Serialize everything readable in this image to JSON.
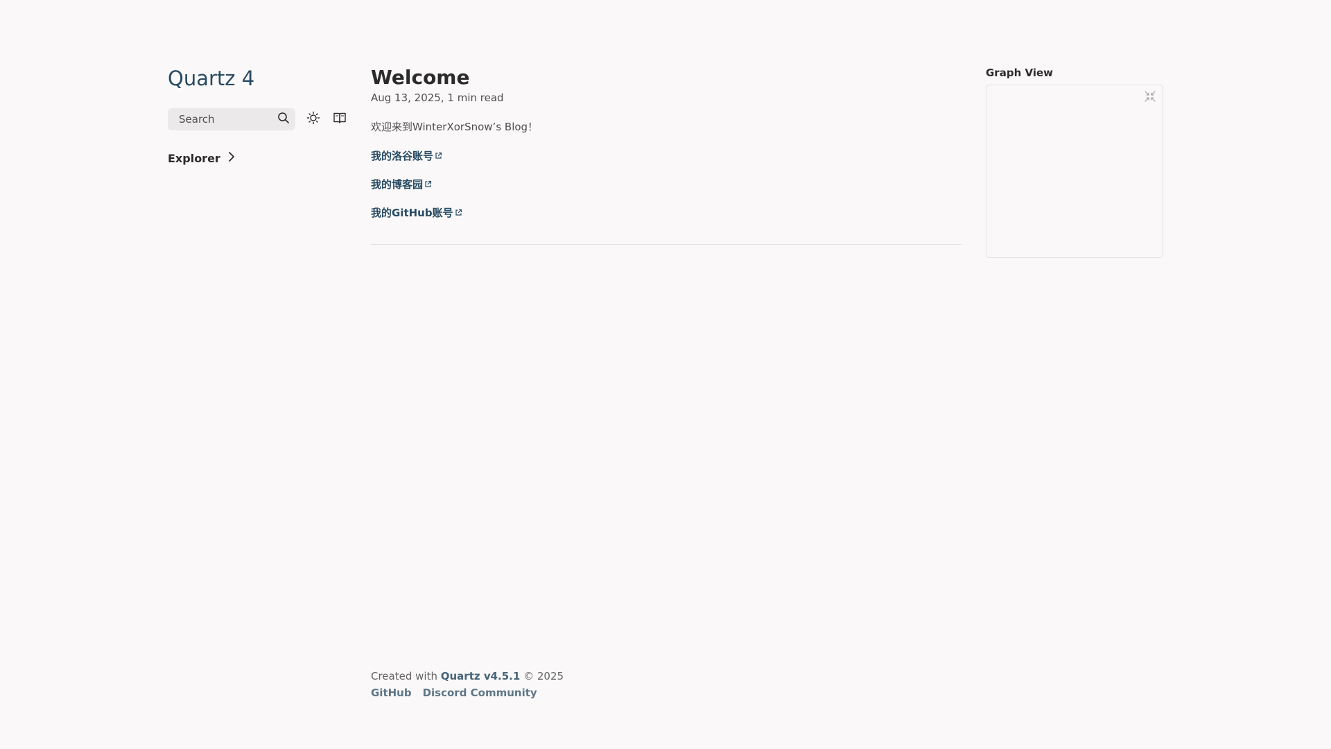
{
  "site": {
    "title": "Quartz 4"
  },
  "toolbar": {
    "search_label": "Search",
    "icons": [
      "search-icon",
      "sun-icon",
      "reader-mode-icon"
    ]
  },
  "sidebar": {
    "explorer_label": "Explorer",
    "explorer_icon": "chevron-right-icon"
  },
  "article": {
    "title": "Welcome",
    "meta": "Aug 13, 2025,  1 min read",
    "intro": "欢迎来到WinterXorSnow’s Blog！",
    "links": [
      {
        "label": "我的洛谷账号",
        "icon": "external-link-icon"
      },
      {
        "label": "我的博客园",
        "icon": "external-link-icon"
      },
      {
        "label": "我的GitHub账号",
        "icon": "external-link-icon"
      }
    ]
  },
  "graph": {
    "title": "Graph View",
    "expand_icon": "expand-icon"
  },
  "footer": {
    "created_prefix": "Created with",
    "quartz_link": "Quartz v4.5.1",
    "copyright": "© 2025",
    "links": [
      "GitHub",
      "Discord Community"
    ]
  },
  "colors": {
    "background": "#faf8f8",
    "accent": "#284b63",
    "text": "#2b2b2b",
    "muted": "#4e4e4e",
    "search_bg": "#ebe9e9",
    "border": "#e3e1e1"
  }
}
